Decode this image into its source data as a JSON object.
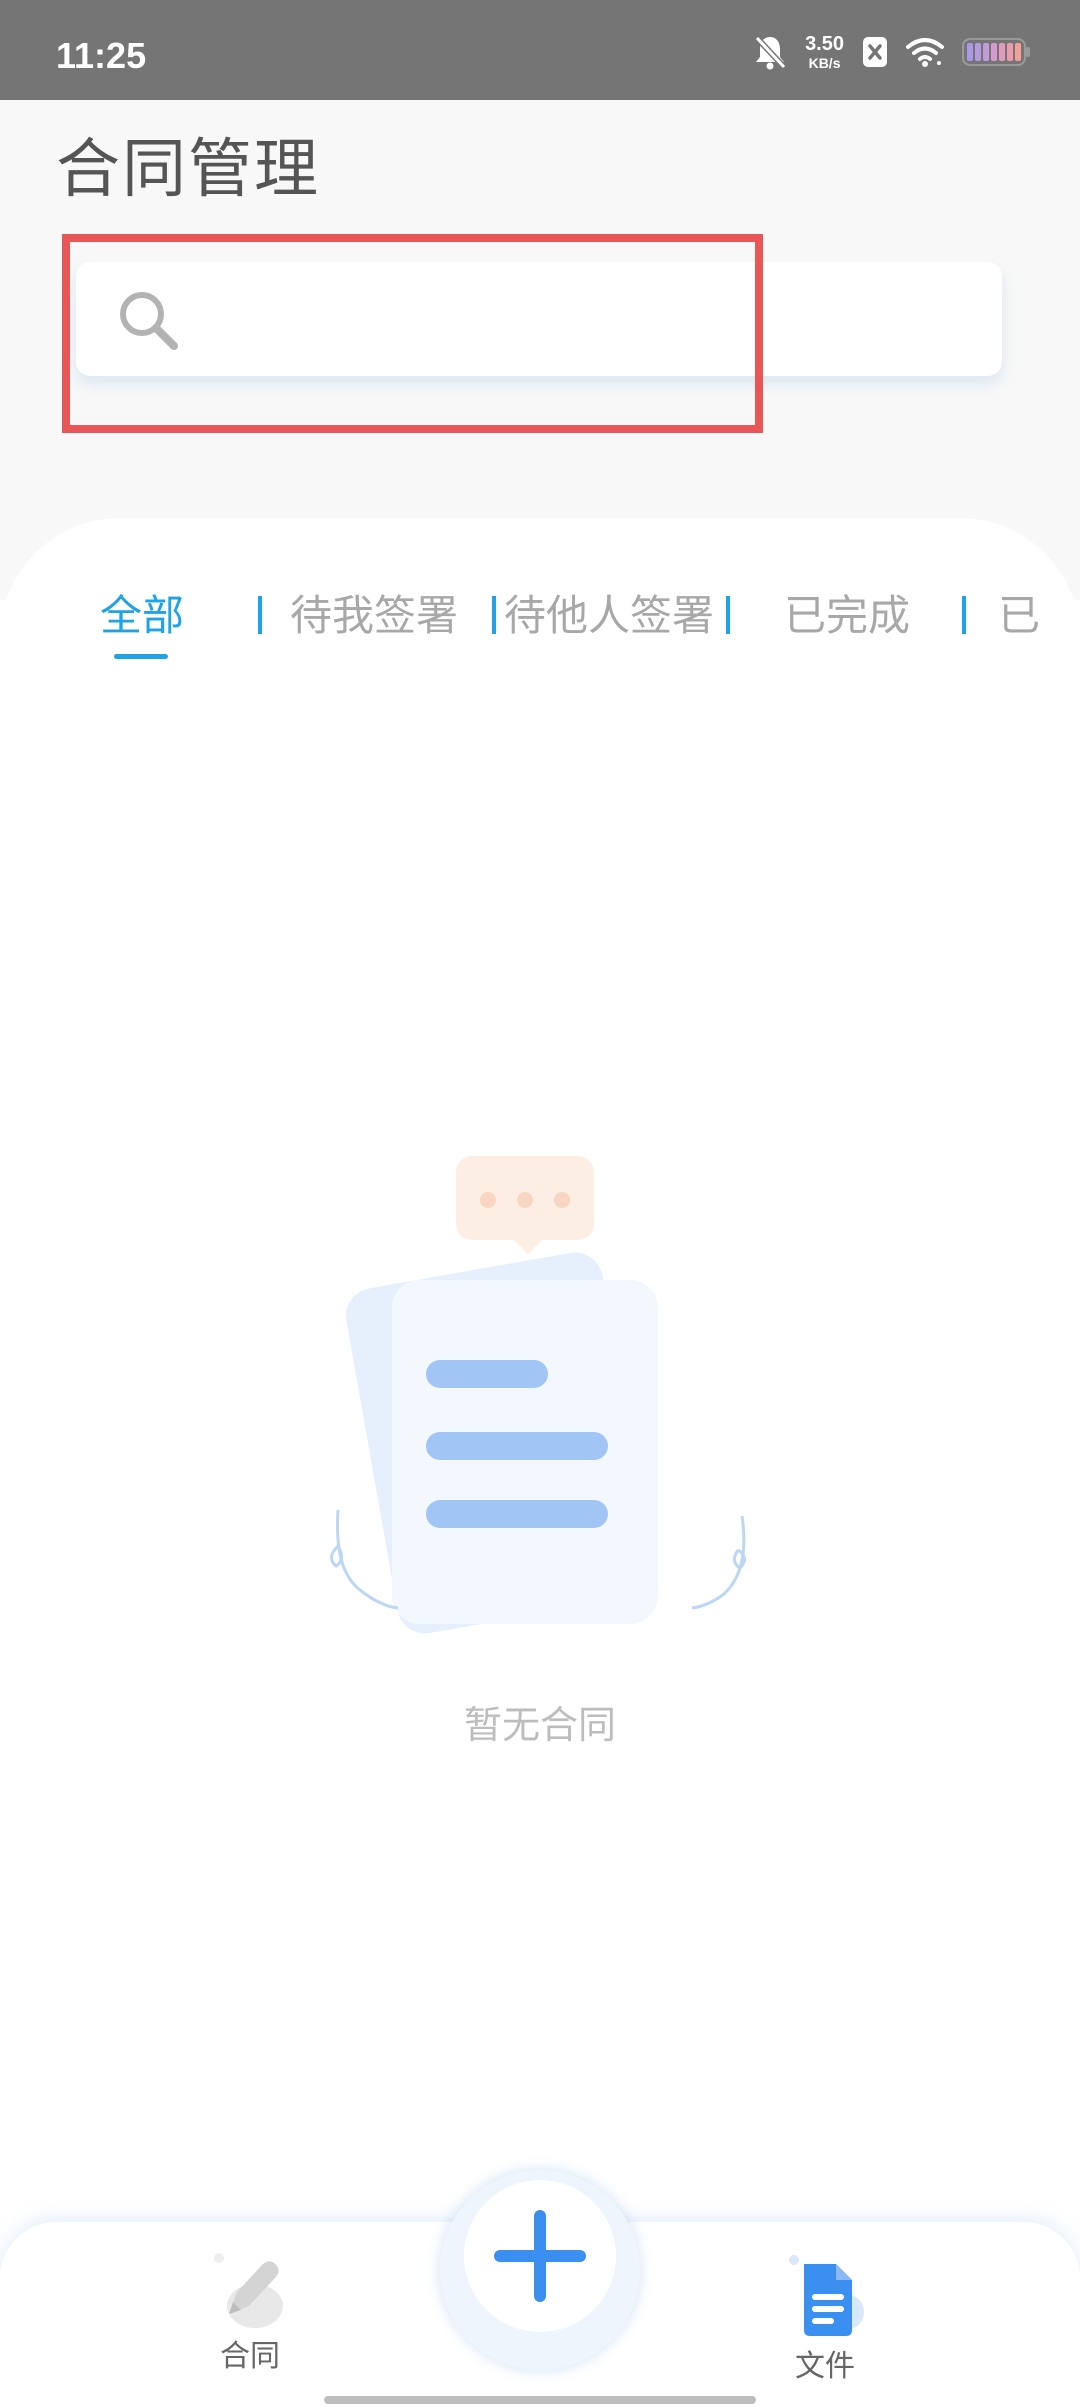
{
  "status_bar": {
    "time": "11:25",
    "net_speed_value": "3.50",
    "net_speed_unit": "KB/s"
  },
  "header": {
    "title": "合同管理"
  },
  "search": {
    "placeholder": ""
  },
  "tabs": [
    {
      "label": "全部",
      "active": true
    },
    {
      "label": "待我签署",
      "active": false
    },
    {
      "label": "待他人签署",
      "active": false
    },
    {
      "label": "已完成",
      "active": false
    },
    {
      "label": "已",
      "active": false
    }
  ],
  "empty_state": {
    "text": "暂无合同"
  },
  "bottom_nav": {
    "contract_label": "合同",
    "file_label": "文件",
    "add_icon": "plus-icon"
  },
  "colors": {
    "accent": "#1ea3e8",
    "fab_blue": "#3b8ff0",
    "highlight": "#e85656",
    "status_bar_bg": "#757575"
  }
}
